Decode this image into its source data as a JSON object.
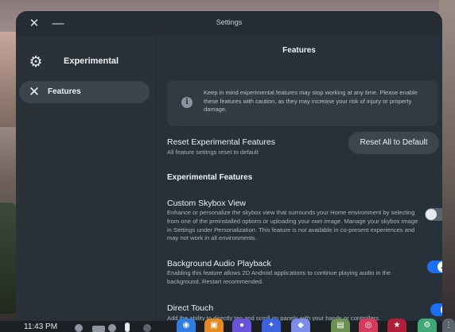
{
  "window": {
    "title": "Settings",
    "close_icon": "close-icon",
    "minimize_icon": "minimize-icon"
  },
  "sidebar": {
    "header": {
      "icon": "gear-icon",
      "label": "Experimental"
    },
    "items": [
      {
        "icon": "close-x-icon",
        "label": "Features",
        "selected": true
      }
    ]
  },
  "main": {
    "title": "Features",
    "notice": {
      "icon": "info-icon",
      "text": "Keep in mind experimental features may stop working at any time. Please enable these features with caution, as they may increase your risk of injury or property damage."
    },
    "reset": {
      "title": "Reset Experimental Features",
      "description": "All feature settings reset to default",
      "button_label": "Reset All to Default"
    },
    "section_title": "Experimental Features",
    "features": [
      {
        "title": "Custom Skybox View",
        "description": "Enhance or personalize the skybox view that surrounds your Home environment by selecting from one of the preinstalled options or uploading your own image. Manage your skybox image in Settings under Personalization. This feature is not available in co-present experiences and may not work in all environments.",
        "enabled": false
      },
      {
        "title": "Background Audio Playback",
        "description": "Enabling this feature allows 2D Android applications to continue playing audio in the background. Restart recommended.",
        "enabled": true
      },
      {
        "title": "Direct Touch",
        "description": "Add the ability to directly tap and scroll on panels with your hands or controllers.",
        "enabled": true
      }
    ]
  },
  "taskbar": {
    "clock": "11:43 PM"
  },
  "colors": {
    "accent": "#1c6ef2",
    "window_bg": "#273139",
    "sidebar_bg": "#2a3238"
  }
}
